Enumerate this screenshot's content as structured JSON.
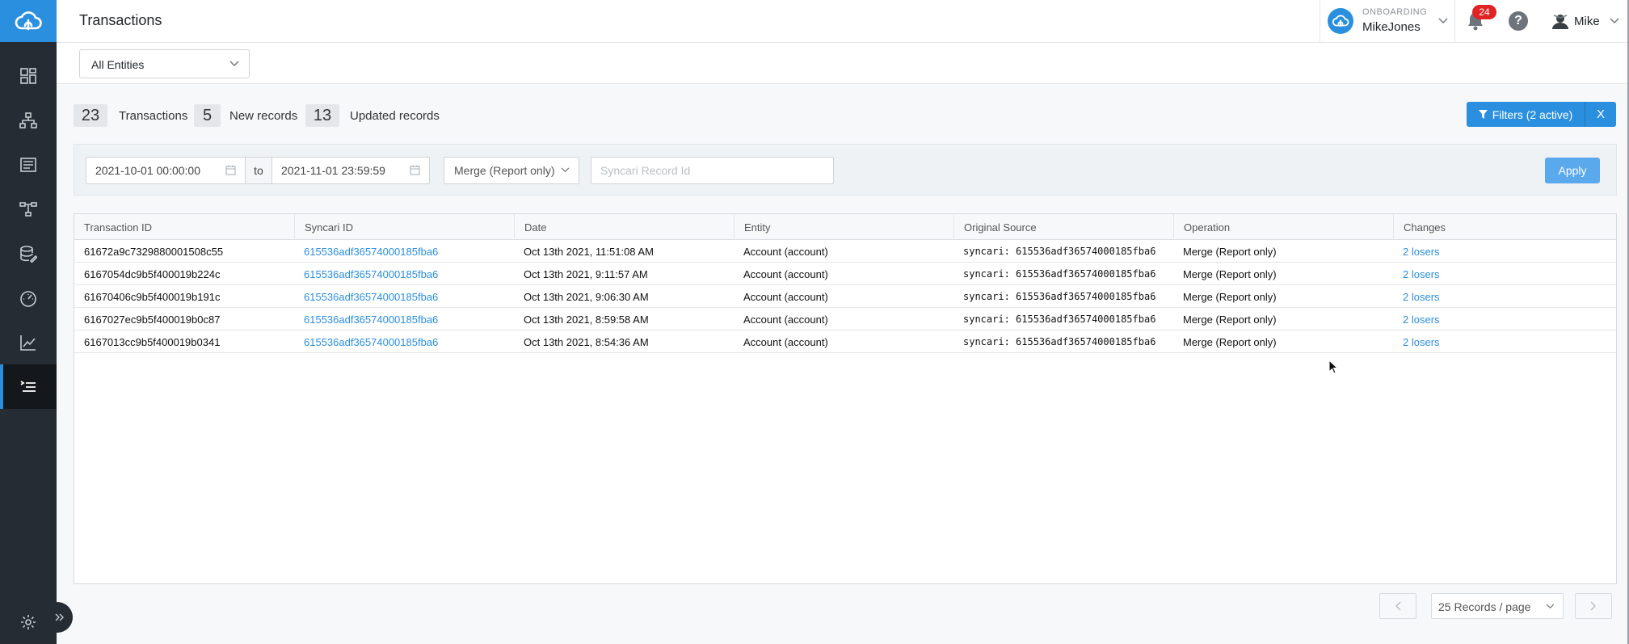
{
  "header": {
    "title": "Transactions",
    "org_label": "ONBOARDING",
    "org_name": "MikeJones",
    "notification_count": "24",
    "help_glyph": "?",
    "user_name": "Mike"
  },
  "sidebar": {
    "items": [
      {
        "icon": "dashboard-icon"
      },
      {
        "icon": "hierarchy-icon"
      },
      {
        "icon": "list-doc-icon"
      },
      {
        "icon": "pipeline-icon"
      },
      {
        "icon": "database-edit-icon"
      },
      {
        "icon": "speedometer-icon"
      },
      {
        "icon": "analytics-chart-icon"
      },
      {
        "icon": "transactions-list-icon",
        "active": true
      }
    ],
    "bottom_icon": "settings-gear-icon",
    "accent_color": "#2b8fe0"
  },
  "entity_filter": {
    "selected": "All Entities"
  },
  "summary": {
    "transactions_count": "23",
    "transactions_label": "Transactions",
    "new_count": "5",
    "new_label": "New records",
    "updated_count": "13",
    "updated_label": "Updated records"
  },
  "filters_button": {
    "label": "Filters (2 active)",
    "close": "X"
  },
  "filter_panel": {
    "date_from": "2021-10-01 00:00:00",
    "to_label": "to",
    "date_to": "2021-11-01 23:59:59",
    "operation": "Merge (Report only)",
    "record_placeholder": "Syncari Record Id",
    "apply_label": "Apply"
  },
  "table": {
    "columns": [
      "Transaction ID",
      "Syncari ID",
      "Date",
      "Entity",
      "Original Source",
      "Operation",
      "Changes"
    ],
    "rows": [
      [
        "61672a9c7329880001508c55",
        "615536adf36574000185fba6",
        "Oct 13th 2021, 11:51:08 AM",
        "Account (account)",
        "syncari: 615536adf36574000185fba6",
        "Merge (Report only)",
        "2 losers"
      ],
      [
        "6167054dc9b5f400019b224c",
        "615536adf36574000185fba6",
        "Oct 13th 2021, 9:11:57 AM",
        "Account (account)",
        "syncari: 615536adf36574000185fba6",
        "Merge (Report only)",
        "2 losers"
      ],
      [
        "61670406c9b5f400019b191c",
        "615536adf36574000185fba6",
        "Oct 13th 2021, 9:06:30 AM",
        "Account (account)",
        "syncari: 615536adf36574000185fba6",
        "Merge (Report only)",
        "2 losers"
      ],
      [
        "6167027ec9b5f400019b0c87",
        "615536adf36574000185fba6",
        "Oct 13th 2021, 8:59:58 AM",
        "Account (account)",
        "syncari: 615536adf36574000185fba6",
        "Merge (Report only)",
        "2 losers"
      ],
      [
        "6167013cc9b5f400019b0341",
        "615536adf36574000185fba6",
        "Oct 13th 2021, 8:54:36 AM",
        "Account (account)",
        "syncari: 615536adf36574000185fba6",
        "Merge (Report only)",
        "2 losers"
      ]
    ]
  },
  "pagination": {
    "page_size": "25 Records / page"
  }
}
